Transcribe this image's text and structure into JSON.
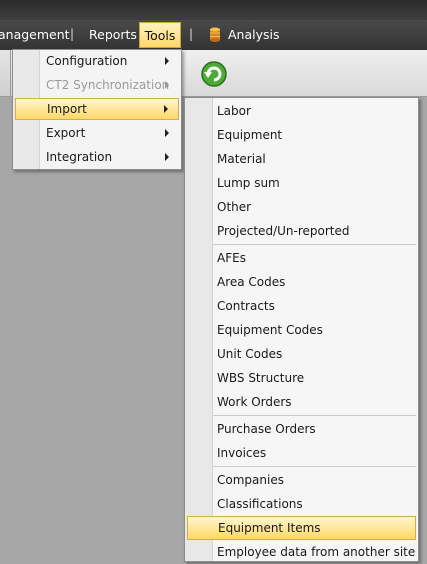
{
  "menubar": {
    "items": [
      {
        "label": "anagement"
      },
      {
        "label": "Reports"
      },
      {
        "label": "Tools"
      },
      {
        "label": "Analysis"
      }
    ],
    "separator": "|"
  },
  "tools_menu": {
    "items": [
      {
        "label": "Configuration",
        "submenu": true,
        "disabled": false
      },
      {
        "label": "CT2 Synchronization",
        "submenu": true,
        "disabled": true
      },
      {
        "label": "Import",
        "submenu": true,
        "highlighted": true
      },
      {
        "label": "Export",
        "submenu": true
      },
      {
        "label": "Integration",
        "submenu": true
      }
    ]
  },
  "import_menu": {
    "groups": [
      [
        "Labor",
        "Equipment",
        "Material",
        "Lump sum",
        "Other",
        "Projected/Un-reported"
      ],
      [
        "AFEs",
        "Area Codes",
        "Contracts",
        "Equipment Codes",
        "Unit Codes",
        "WBS Structure",
        "Work Orders"
      ],
      [
        "Purchase Orders",
        "Invoices"
      ],
      [
        "Companies",
        "Classifications",
        "Equipment Items",
        "Employee data from another site"
      ]
    ],
    "highlighted": "Equipment Items"
  },
  "colors": {
    "highlight_top": "#fff6cf",
    "highlight_bottom": "#ffd867",
    "menubar": "#3a3a3a",
    "workspace": "#a7a7a7",
    "refresh_green": "#3f9a2a"
  }
}
